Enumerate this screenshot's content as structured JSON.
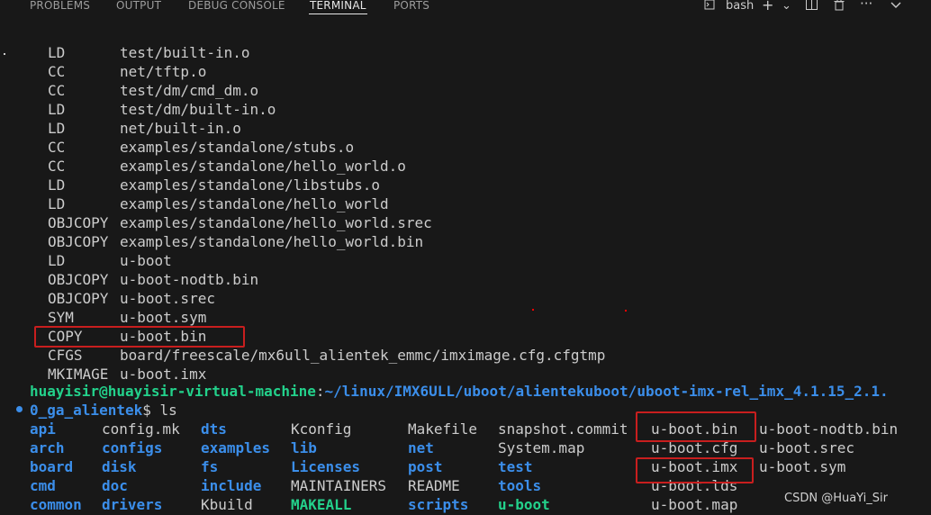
{
  "panel_tabs": [
    {
      "label": "PROBLEMS",
      "active": false
    },
    {
      "label": "OUTPUT",
      "active": false
    },
    {
      "label": "DEBUG CONSOLE",
      "active": false
    },
    {
      "label": "TERMINAL",
      "active": true
    },
    {
      "label": "PORTS",
      "active": false
    }
  ],
  "toolbar": {
    "shell_name": "bash",
    "new_terminal": "+",
    "dropdown": "⌄",
    "split": "⧉",
    "kill": "🗑",
    "more": "···",
    "collapse": "⌃"
  },
  "build_lines": [
    {
      "cmd": "LD",
      "arg": "test/built-in.o"
    },
    {
      "cmd": "CC",
      "arg": "net/tftp.o"
    },
    {
      "cmd": "CC",
      "arg": "test/dm/cmd_dm.o"
    },
    {
      "cmd": "LD",
      "arg": "test/dm/built-in.o"
    },
    {
      "cmd": "LD",
      "arg": "net/built-in.o"
    },
    {
      "cmd": "CC",
      "arg": "examples/standalone/stubs.o"
    },
    {
      "cmd": "CC",
      "arg": "examples/standalone/hello_world.o"
    },
    {
      "cmd": "LD",
      "arg": "examples/standalone/libstubs.o"
    },
    {
      "cmd": "LD",
      "arg": "examples/standalone/hello_world"
    },
    {
      "cmd": "OBJCOPY",
      "arg": "examples/standalone/hello_world.srec"
    },
    {
      "cmd": "OBJCOPY",
      "arg": "examples/standalone/hello_world.bin"
    },
    {
      "cmd": "LD",
      "arg": "u-boot"
    },
    {
      "cmd": "OBJCOPY",
      "arg": "u-boot-nodtb.bin"
    },
    {
      "cmd": "OBJCOPY",
      "arg": "u-boot.srec"
    },
    {
      "cmd": "SYM",
      "arg": "u-boot.sym"
    },
    {
      "cmd": "COPY",
      "arg": "u-boot.bin"
    },
    {
      "cmd": "CFGS",
      "arg": "board/freescale/mx6ull_alientek_emmc/imximage.cfg.cfgtmp"
    },
    {
      "cmd": "MKIMAGE",
      "arg": "u-boot.imx"
    }
  ],
  "prompt": {
    "user_host": "huayisir@huayisir-virtual-machine",
    "separator": ":",
    "path_line1": "~/linux/IMX6ULL/uboot/alientekuboot/uboot-imx-rel_imx_4.1.15_2.1.",
    "path_line2": "0_ga_alientek",
    "suffix": "$ ls"
  },
  "ls_columns": [
    [
      {
        "name": "api",
        "type": "dir"
      },
      {
        "name": "arch",
        "type": "dir"
      },
      {
        "name": "board",
        "type": "dir"
      },
      {
        "name": "cmd",
        "type": "dir"
      },
      {
        "name": "common",
        "type": "dir"
      }
    ],
    [
      {
        "name": "config.mk",
        "type": "file"
      },
      {
        "name": "configs",
        "type": "dir"
      },
      {
        "name": "disk",
        "type": "dir"
      },
      {
        "name": "doc",
        "type": "dir"
      },
      {
        "name": "drivers",
        "type": "dir"
      }
    ],
    [
      {
        "name": "dts",
        "type": "dir"
      },
      {
        "name": "examples",
        "type": "dir"
      },
      {
        "name": "fs",
        "type": "dir"
      },
      {
        "name": "include",
        "type": "dir"
      },
      {
        "name": "Kbuild",
        "type": "file"
      }
    ],
    [
      {
        "name": "Kconfig",
        "type": "file"
      },
      {
        "name": "lib",
        "type": "dir"
      },
      {
        "name": "Licenses",
        "type": "dir"
      },
      {
        "name": "MAINTAINERS",
        "type": "file"
      },
      {
        "name": "MAKEALL",
        "type": "exe"
      }
    ],
    [
      {
        "name": "Makefile",
        "type": "file"
      },
      {
        "name": "net",
        "type": "dir"
      },
      {
        "name": "post",
        "type": "dir"
      },
      {
        "name": "README",
        "type": "file"
      },
      {
        "name": "scripts",
        "type": "dir"
      }
    ],
    [
      {
        "name": "snapshot.commit",
        "type": "file"
      },
      {
        "name": "System.map",
        "type": "file"
      },
      {
        "name": "test",
        "type": "dir"
      },
      {
        "name": "tools",
        "type": "dir"
      },
      {
        "name": "u-boot",
        "type": "exe"
      }
    ],
    [
      {
        "name": "u-boot.bin",
        "type": "file"
      },
      {
        "name": "u-boot.cfg",
        "type": "file"
      },
      {
        "name": "u-boot.imx",
        "type": "file"
      },
      {
        "name": "u-boot.lds",
        "type": "file"
      },
      {
        "name": "u-boot.map",
        "type": "file"
      }
    ],
    [
      {
        "name": "u-boot-nodtb.bin",
        "type": "file"
      },
      {
        "name": "u-boot.srec",
        "type": "file"
      },
      {
        "name": "u-boot.sym",
        "type": "file"
      }
    ]
  ],
  "watermark": "CSDN @HuaYi_Sir",
  "colors": {
    "background": "#181818",
    "text": "#cccccc",
    "dir": "#3b8eea",
    "exe": "#23d18b",
    "highlight_box": "#c81e1e"
  }
}
